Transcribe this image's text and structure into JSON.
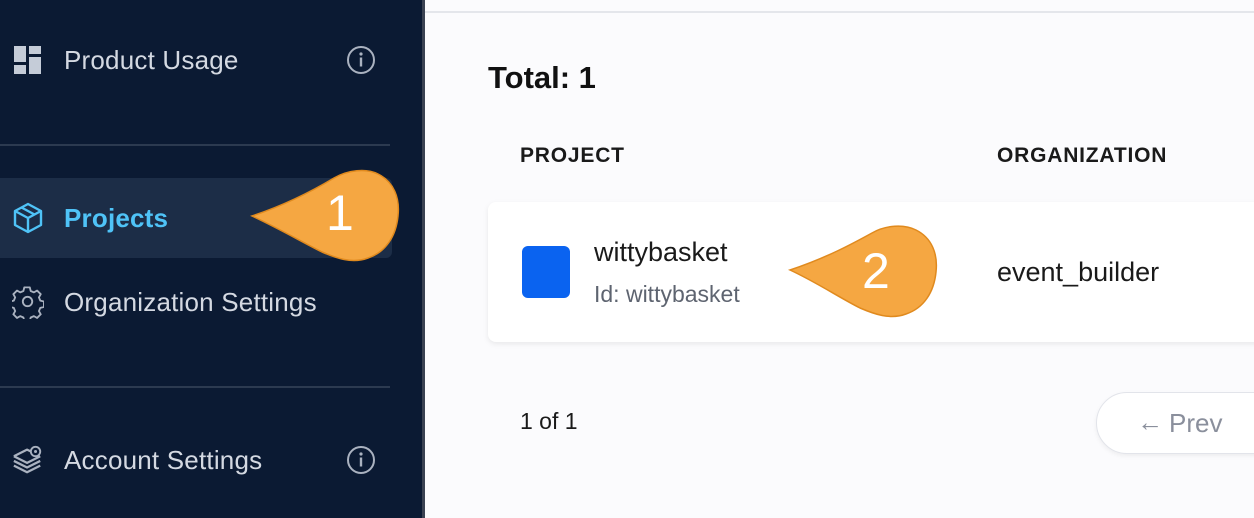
{
  "sidebar": {
    "items": [
      {
        "label": "Product Usage",
        "icon": "dashboard-icon",
        "info": true
      },
      {
        "label": "Projects",
        "icon": "cube-icon",
        "active": true
      },
      {
        "label": "Organization Settings",
        "icon": "gear-icon"
      },
      {
        "label": "Account Settings",
        "icon": "layers-gear-icon",
        "info": true
      }
    ]
  },
  "main": {
    "total": "Total: 1",
    "columns": [
      "PROJECT",
      "ORGANIZATION"
    ],
    "rows": [
      {
        "project_name": "wittybasket",
        "project_id": "Id: wittybasket",
        "organization": "event_builder",
        "color": "#0a63f0"
      }
    ],
    "pagination": {
      "page_text": "1 of 1",
      "prev_arrow": "←",
      "prev_label": "Prev"
    }
  },
  "callouts": [
    {
      "number": "1"
    },
    {
      "number": "2"
    }
  ],
  "colors": {
    "sidebar_bg": "#0b1a33",
    "active_text": "#4fc3f7",
    "callout": "#f5a742",
    "project_square": "#0a63f0"
  }
}
